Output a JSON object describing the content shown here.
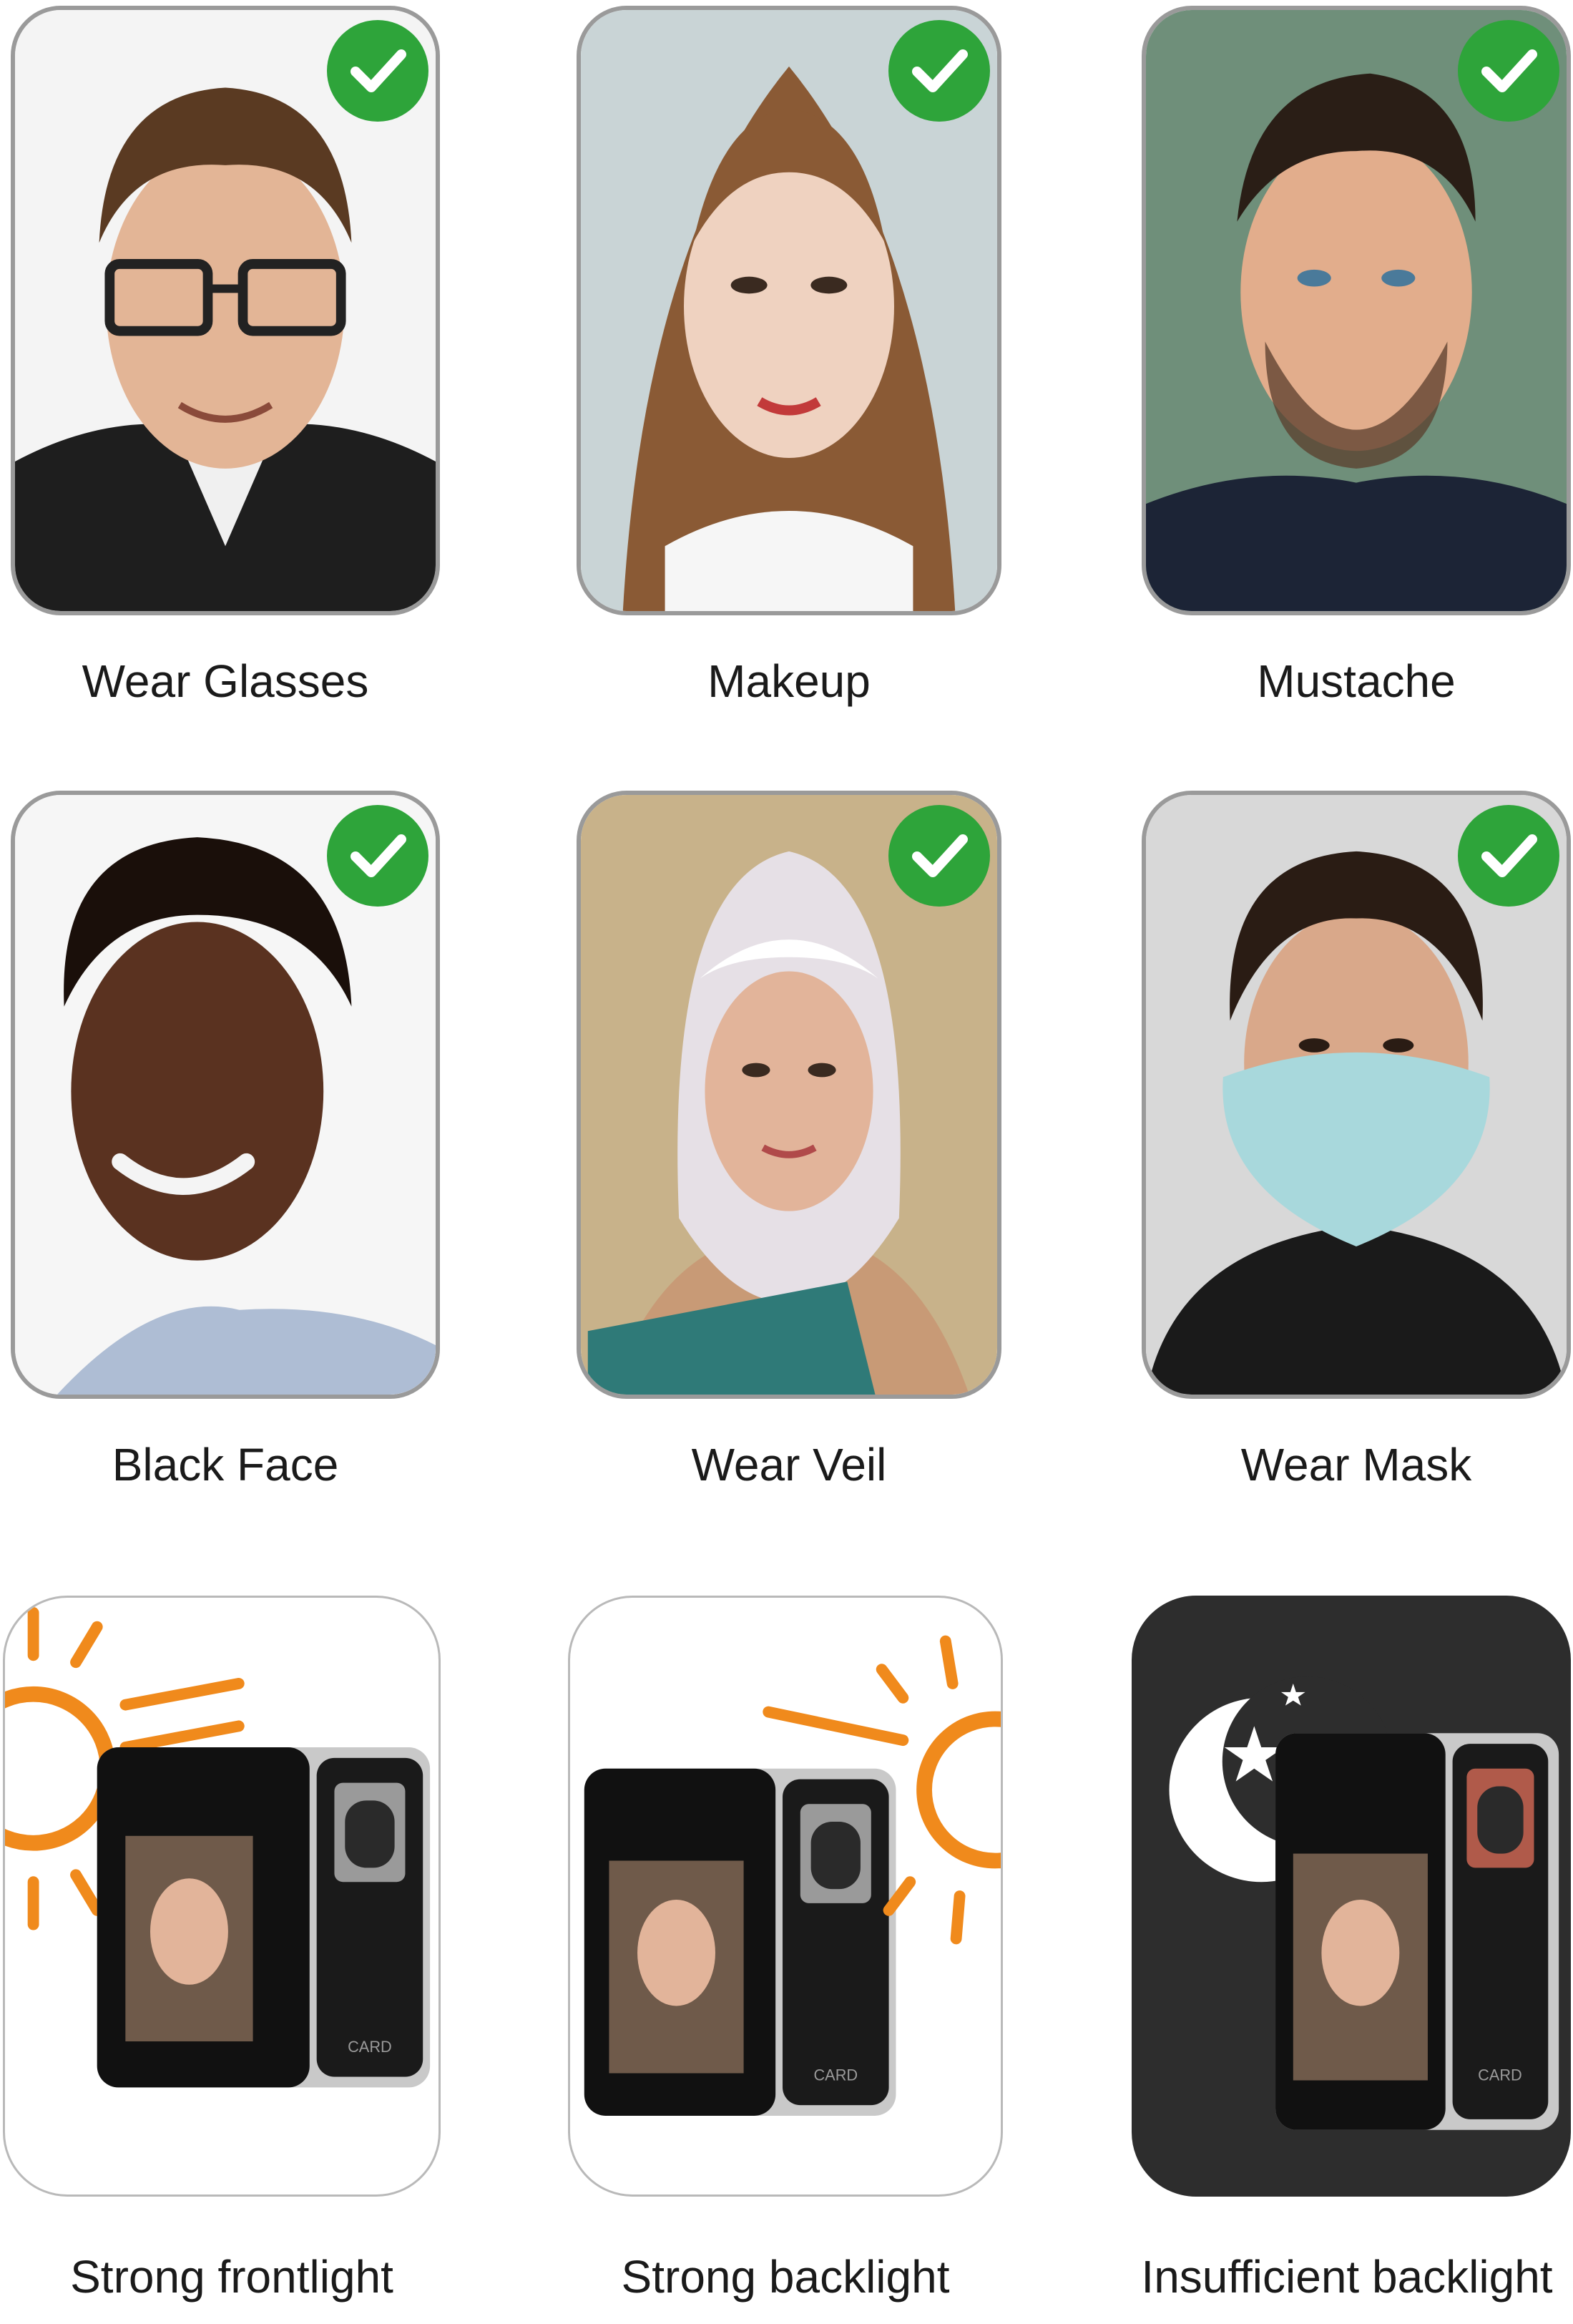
{
  "items": [
    {
      "caption": "Wear Glasses",
      "status": "check-icon"
    },
    {
      "caption": "Makeup",
      "status": "check-icon"
    },
    {
      "caption": "Mustache",
      "status": "check-icon"
    },
    {
      "caption": "Black Face",
      "status": "check-icon"
    },
    {
      "caption": "Wear Veil",
      "status": "check-icon"
    },
    {
      "caption": "Wear Mask",
      "status": "check-icon"
    }
  ],
  "conditions": [
    {
      "caption": "Strong frontlight",
      "icon": "sun-icon"
    },
    {
      "caption": "Strong backlight",
      "icon": "sun-icon"
    },
    {
      "caption": "Insufficient backlight",
      "icon": "moon-icon"
    }
  ],
  "device_brand": "CARD",
  "colors": {
    "check": "#2ea43a",
    "sun": "#f08a1c",
    "dark_bg": "#2d2d2d",
    "border": "#9a9a9a"
  }
}
